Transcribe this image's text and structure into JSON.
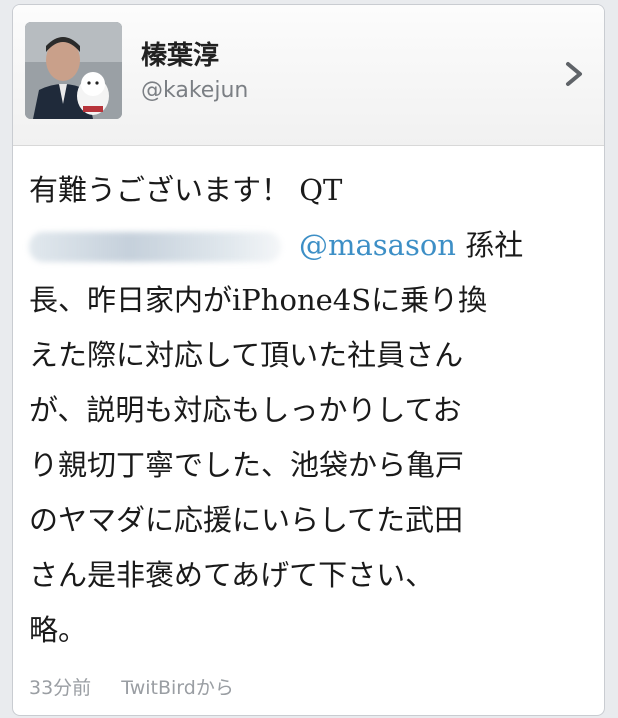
{
  "author": {
    "name": "榛葉淳",
    "handle": "@kakejun"
  },
  "tweet": {
    "line1_text": "有難うございます！",
    "line1_qt": "QT",
    "line2_mention": "@masason",
    "line2_text": "孫社",
    "line3_a": "長、昨日家内が",
    "line3_b": "iPhone4S",
    "line3_c": "に乗り換",
    "line4": "えた際に対応して頂いた社員さん",
    "line5": "が、説明も対応もしっかりしてお",
    "line6": "り親切丁寧でした、池袋から亀戸",
    "line7": "のヤマダに応援にいらしてた武田",
    "line8": "さん是非褒めてあげて下さい、",
    "line9": "略。"
  },
  "meta": {
    "time": "33分前",
    "source": "TwitBirdから"
  }
}
